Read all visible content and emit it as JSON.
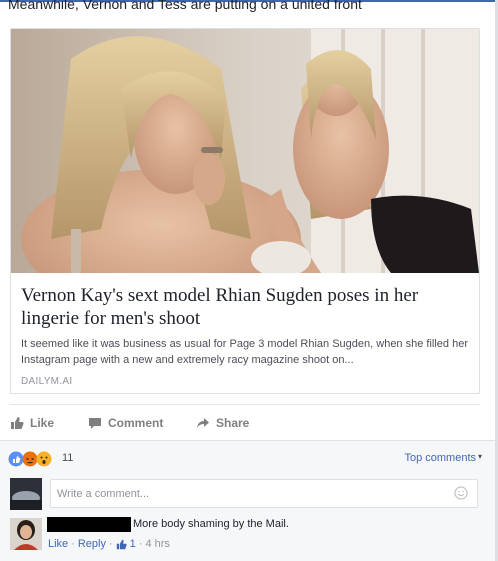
{
  "post": {
    "caption": "Meanwhile, Vernon and Tess are putting on a united front"
  },
  "link_card": {
    "headline": "Vernon Kay's sext model Rhian Sugden poses in her lingerie for men's shoot",
    "summary": "It seemed like it was business as usual for Page 3 model Rhian Sugden, when she filled her Instagram page with a new and extremely racy magazine shoot on...",
    "domain": "DAILYM.AI"
  },
  "actions": {
    "like": "Like",
    "comment": "Comment",
    "share": "Share"
  },
  "reactions": {
    "icons": [
      "like-icon",
      "angry-icon",
      "wow-icon"
    ],
    "count": "11",
    "sort_label": "Top comments"
  },
  "composer": {
    "placeholder": "Write a comment..."
  },
  "comments": [
    {
      "text": "More body shaming by the Mail.",
      "like": "Like",
      "reply": "Reply",
      "likes": "1",
      "time": "4 hrs"
    }
  ],
  "colors": {
    "accent": "#4267b2",
    "muted": "#90949c",
    "panel": "#f6f7f9"
  }
}
